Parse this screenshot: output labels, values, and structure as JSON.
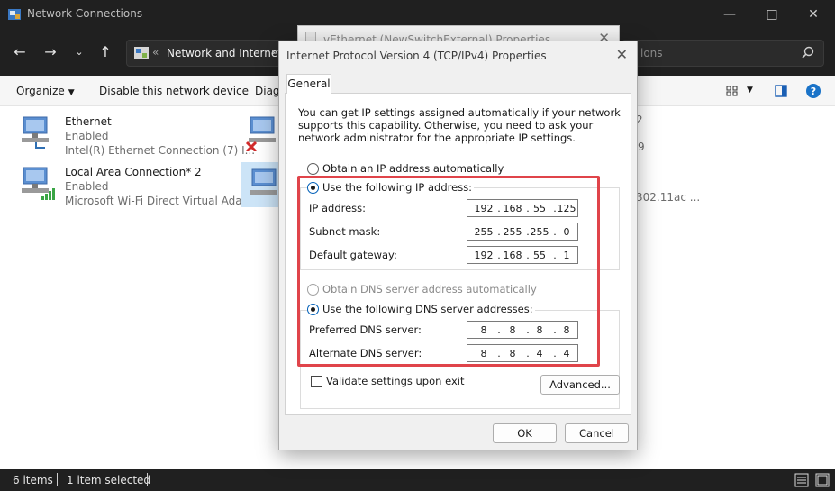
{
  "explorer": {
    "title": "Network Connections",
    "address_segment": "Network and Internet",
    "search_placeholder": "ions",
    "commands": {
      "organize": "Organize",
      "disable": "Disable this network device",
      "diagnose": "Diagn"
    },
    "items": [
      {
        "name": "Ethernet",
        "status": "Enabled",
        "device": "Intel(R) Ethernet Connection (7) I..."
      },
      {
        "name": "Local Area Connection* 2",
        "status": "Enabled",
        "device": "Microsoft Wi-Fi Direct Virtual Ada..."
      }
    ],
    "hidden_right": {
      "c1": "2",
      "c2": "9",
      "c3": "302.11ac ..."
    },
    "statusbar": {
      "count": "6 items",
      "selection": "1 item selected"
    }
  },
  "bg_dialog": {
    "title": "vEthernet (NewSwitchExternal) Properties"
  },
  "dialog": {
    "title": "Internet Protocol Version 4 (TCP/IPv4) Properties",
    "tab": "General",
    "intro": "You can get IP settings assigned automatically if your network supports this capability. Otherwise, you need to ask your network administrator for the appropriate IP settings.",
    "ip_auto": "Obtain an IP address automatically",
    "ip_manual": "Use the following IP address:",
    "ip_label": "IP address:",
    "subnet_label": "Subnet mask:",
    "gateway_label": "Default gateway:",
    "ip": [
      "192",
      "168",
      "55",
      "125"
    ],
    "subnet": [
      "255",
      "255",
      "255",
      "0"
    ],
    "gateway": [
      "192",
      "168",
      "55",
      "1"
    ],
    "dns_auto": "Obtain DNS server address automatically",
    "dns_manual": "Use the following DNS server addresses:",
    "pref_label": "Preferred DNS server:",
    "alt_label": "Alternate DNS server:",
    "pref": [
      "8",
      "8",
      "8",
      "8"
    ],
    "alt": [
      "8",
      "8",
      "4",
      "4"
    ],
    "validate": "Validate settings upon exit",
    "advanced": "Advanced...",
    "ok": "OK",
    "cancel": "Cancel"
  },
  "colors": {
    "accent": "#005fb8",
    "highlight": "#e0444a",
    "dark": "#202020"
  }
}
